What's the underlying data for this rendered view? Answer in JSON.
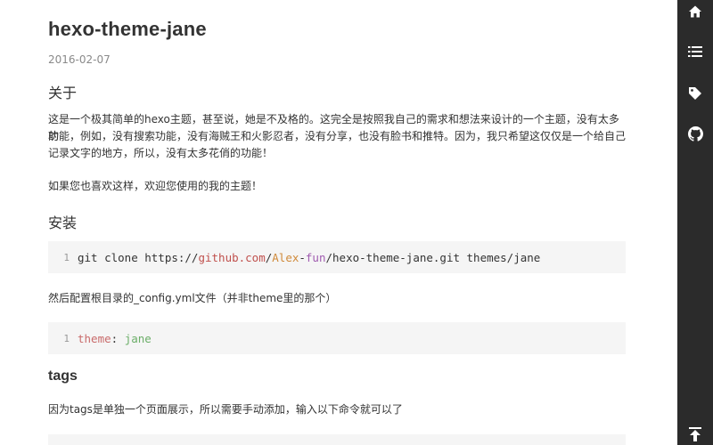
{
  "post": {
    "title": "hexo-theme-jane",
    "date": "2016-02-07"
  },
  "sections": {
    "about_heading": "关于",
    "about_p1_line1": "这是一个极其简单的hexo主题，甚至说，她是不及格的。这完全是按照我自己的需求和想法来设计的一个主题，没有太多的",
    "about_p1_line2": "功能，例如，没有搜索功能，没有海贼王和火影忍者，没有分享，也没有脸书和推特。因为，我只希望这仅仅是一个给自己",
    "about_p1_line3": "记录文字的地方，所以，没有太多花俏的功能！",
    "about_p2": "如果您也喜欢这样，欢迎您使用的我的主题！",
    "install_heading": "安装",
    "code1": {
      "line_no": "1",
      "prefix": "git clone https://",
      "host": "github.com",
      "slash1": "/",
      "user1": "Alex",
      "dash": "-",
      "user2": "fun",
      "slash2": "/",
      "suffix": "hexo-theme-jane.git themes/jane"
    },
    "config_note": "然后配置根目录的_config.yml文件（并非theme里的那个）",
    "code2": {
      "line_no": "1",
      "key": "theme",
      "colon": ": ",
      "value": "jane"
    },
    "tags_heading": "tags",
    "tags_note": "因为tags是单独一个页面展示，所以需要手动添加，输入以下命令就可以了"
  },
  "sidebar": {
    "icons": [
      "home-icon",
      "list-icon",
      "tag-icon",
      "github-icon",
      "back-to-top-icon"
    ]
  },
  "colors": {
    "sidebar_bg": "#2b2b2b",
    "code_bg": "#f5f5f5",
    "text": "#333333",
    "date": "#8a8a8a"
  }
}
